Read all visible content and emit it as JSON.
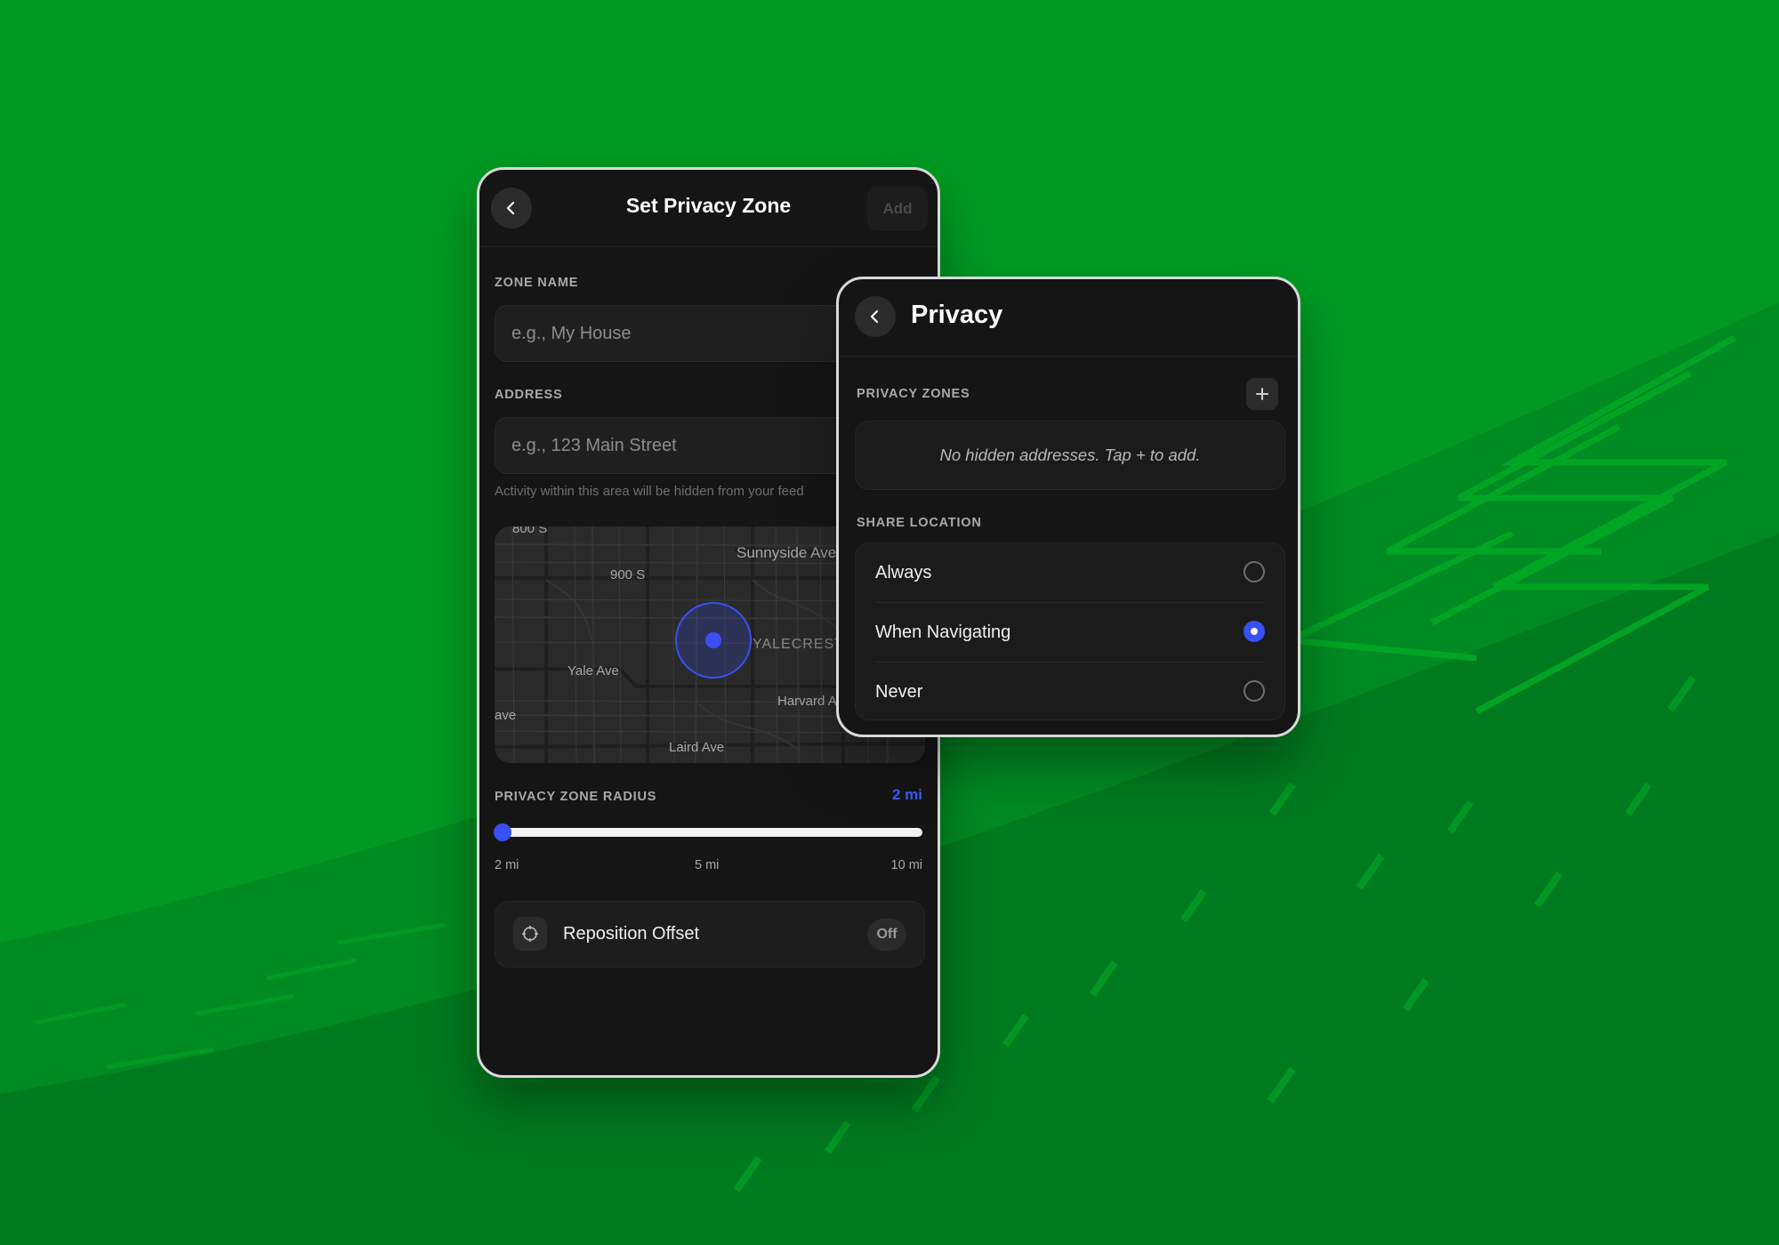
{
  "colors": {
    "background": "#009a23",
    "accent": "#3850f5",
    "panel": "#151515"
  },
  "zone_screen": {
    "title": "Set Privacy Zone",
    "add_label": "Add",
    "zone_name": {
      "label": "ZONE NAME",
      "placeholder": "e.g., My House",
      "value": ""
    },
    "address": {
      "label": "ADDRESS",
      "placeholder": "e.g., 123 Main Street",
      "value": ""
    },
    "helper_text": "Activity within this area will be hidden from your feed",
    "map": {
      "labels": [
        "800 S",
        "900 S",
        "Sunnyside Ave",
        "Yale Ave",
        "YALECREST",
        "Harvard Ave",
        "ave",
        "Laird Ave"
      ]
    },
    "radius": {
      "label": "PRIVACY ZONE RADIUS",
      "value_text": "2 mi",
      "value_fraction": 0,
      "ticks": [
        "2 mi",
        "5 mi",
        "10 mi"
      ]
    },
    "reposition": {
      "label": "Reposition Offset",
      "state": "Off",
      "icon": "crosshair-icon"
    }
  },
  "privacy_screen": {
    "title": "Privacy",
    "zones_label": "PRIVACY ZONES",
    "add_icon": "plus-icon",
    "empty_text": "No hidden addresses. Tap + to add.",
    "share_label": "SHARE LOCATION",
    "options": [
      {
        "label": "Always",
        "selected": false
      },
      {
        "label": "When Navigating",
        "selected": true
      },
      {
        "label": "Never",
        "selected": false
      }
    ]
  }
}
